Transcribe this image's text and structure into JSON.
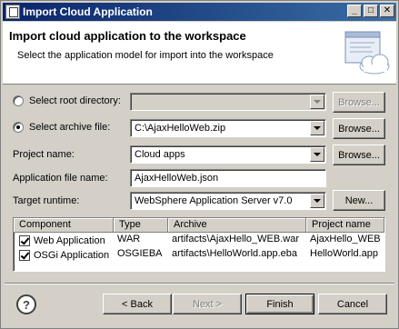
{
  "window": {
    "title": "Import Cloud Application",
    "controls": {
      "minimize": "_",
      "maximize": "□",
      "close": "✕"
    }
  },
  "header": {
    "title": "Import cloud application to the workspace",
    "description": "Select the application model for import into the workspace"
  },
  "form": {
    "root_directory": {
      "label": "Select root directory:",
      "value": "",
      "checked": false,
      "browse": "Browse..."
    },
    "archive_file": {
      "label": "Select archive file:",
      "value": "C:\\AjaxHelloWeb.zip",
      "checked": true,
      "browse": "Browse..."
    },
    "project_name": {
      "label": "Project name:",
      "value": "Cloud apps",
      "browse": "Browse..."
    },
    "app_file_name": {
      "label": "Application file name:",
      "value": "AjaxHelloWeb.json"
    },
    "target_runtime": {
      "label": "Target runtime:",
      "value": "WebSphere Application Server v7.0",
      "new": "New..."
    }
  },
  "table": {
    "columns": [
      "Component",
      "Type",
      "Archive",
      "Project name"
    ],
    "rows": [
      {
        "checked": true,
        "component": "Web Application",
        "type": "WAR",
        "archive": "artifacts\\AjaxHello_WEB.war",
        "project": "AjaxHello_WEB"
      },
      {
        "checked": true,
        "component": "OSGi Application",
        "type": "OSGIEBA",
        "archive": "artifacts\\HelloWorld.app.eba",
        "project": "HelloWorld.app"
      }
    ]
  },
  "footer": {
    "help": "?",
    "back": "< Back",
    "next": "Next >",
    "finish": "Finish",
    "cancel": "Cancel"
  }
}
